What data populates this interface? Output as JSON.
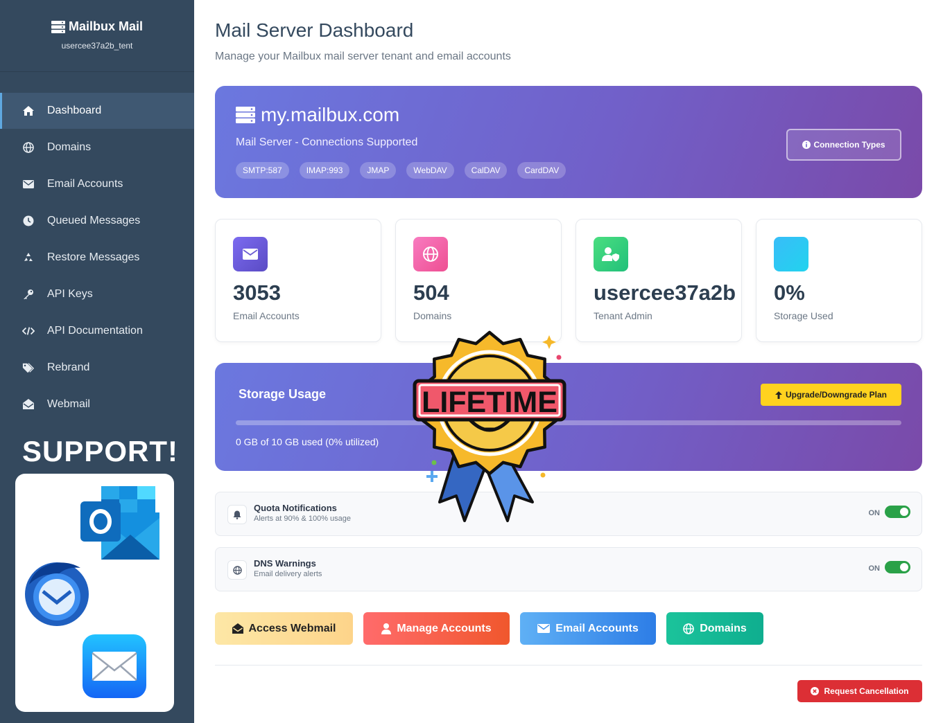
{
  "brand": {
    "title": "Mailbux Mail",
    "username": "usercee37a2b_tent"
  },
  "nav": [
    {
      "label": "Dashboard",
      "icon": "home-icon",
      "active": true
    },
    {
      "label": "Domains",
      "icon": "globe-icon"
    },
    {
      "label": "Email Accounts",
      "icon": "envelope-icon"
    },
    {
      "label": "Queued Messages",
      "icon": "clock-icon"
    },
    {
      "label": "Restore Messages",
      "icon": "recycle-icon"
    },
    {
      "label": "API Keys",
      "icon": "key-icon"
    },
    {
      "label": "API Documentation",
      "icon": "code-icon"
    },
    {
      "label": "Rebrand",
      "icon": "tags-icon"
    },
    {
      "label": "Webmail",
      "icon": "envelope-open-icon"
    }
  ],
  "support": {
    "title": "SUPPORT!"
  },
  "header": {
    "title": "Mail Server Dashboard",
    "subtitle": "Manage your Mailbux mail server tenant and email accounts"
  },
  "hero": {
    "host": "my.mailbux.com",
    "subtitle": "Mail Server - Connections Supported",
    "protocols": [
      "SMTP:587",
      "IMAP:993",
      "JMAP",
      "WebDAV",
      "CalDAV",
      "CardDAV"
    ],
    "connection_button": "Connection Types"
  },
  "stats": [
    {
      "value": "3053",
      "label": "Email Accounts",
      "icon": "envelope-icon",
      "color": "#6c5dd3"
    },
    {
      "value": "504",
      "label": "Domains",
      "icon": "globe-icon",
      "color": "#f25ca2"
    },
    {
      "value": "usercee37a2b",
      "label": "Tenant Admin",
      "icon": "user-shield-icon",
      "color": "#3fd07e"
    },
    {
      "value": "0%",
      "label": "Storage Used",
      "icon": "database-icon",
      "color": "#2bb5f8"
    }
  ],
  "storage": {
    "title": "Storage Usage",
    "upgrade_button": "Upgrade/Downgrade Plan",
    "used_fraction": 0,
    "text": "0 GB of 10 GB used (0% utilized)"
  },
  "notifications": [
    {
      "title": "Quota Notifications",
      "subtitle": "Alerts at 90% & 100% usage",
      "state": "ON",
      "icon": "bell-icon"
    },
    {
      "title": "DNS Warnings",
      "subtitle": "Email delivery alerts",
      "state": "ON",
      "icon": "globe-icon"
    }
  ],
  "actions": [
    {
      "label": "Access Webmail",
      "icon": "envelope-open-icon"
    },
    {
      "label": "Manage Accounts",
      "icon": "user-icon"
    },
    {
      "label": "Email Accounts",
      "icon": "envelope-icon"
    },
    {
      "label": "Domains",
      "icon": "globe-icon"
    }
  ],
  "cancel_button": "Request Cancellation",
  "badge": {
    "text": "LIFETIME"
  }
}
